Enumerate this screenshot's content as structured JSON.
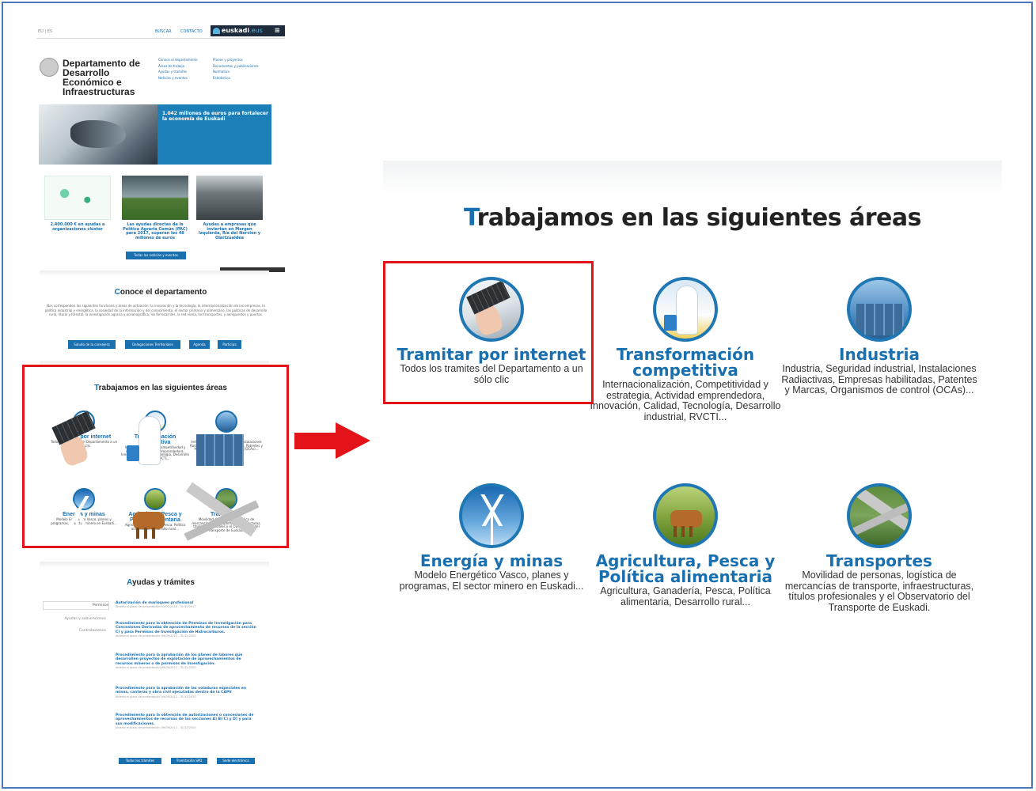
{
  "thumbnail": {
    "topbar": {
      "eu": "EU | ES",
      "buscar": "BUSCAR",
      "contacto": "CONTACTO",
      "brand": "euskadi",
      "brand_tld": ".eus",
      "menu_icon": "hamburger-icon"
    },
    "department": {
      "title": "Departamento de Desarrollo Económico e Infraestructuras",
      "links_col1": [
        "Conoce el departamento",
        "Áreas de trabajo",
        "Ayudas y trámites",
        "Noticias y eventos"
      ],
      "links_col2": [
        "Planes y proyectos",
        "Documentos y publicaciones",
        "Normativa",
        "Estadística"
      ]
    },
    "hero": {
      "text": "1.042 millones de euros para fortalecer la economía de Euskadi"
    },
    "news": [
      {
        "caption": "2.400.000 € en ayudas a organizaciones clúster"
      },
      {
        "caption": "Las ayudas directas de la Política Agraria Común (PAC) para 2017, superan los 48 millones de euros"
      },
      {
        "caption": "Ayudas a empresas que inviertan en Margen Izquierda, Ría del Nervión y Oiartzualdea"
      }
    ],
    "news_button": "Todas las noticias y eventos",
    "conoce": {
      "title_first": "C",
      "title_rest": "onoce el departamento",
      "text": "Nos corresponden las siguientes funciones y áreas de actuación: la innovación y la tecnología, la internacionalización de las empresas, la política industrial y energética, la sociedad de la información y del conocimiento, el sector primario y alimentario, las políticas de desarrollo rural, litoral y forestal, la investigación agraria y oceanográfica, los ferrocarriles, la red viaria, los transportes, y aeropuertos y puertos.",
      "buttons": [
        "Saludo de la consejera",
        "Delegaciones Territoriales",
        "Agenda",
        "Participa"
      ]
    },
    "areas": {
      "title_first": "T",
      "title_rest": "rabajamos en las siguientes áreas",
      "items": [
        {
          "title": "Tramitar por internet",
          "desc": "Todos los trámites del Departamento a un sólo clic"
        },
        {
          "title": "Transformación competitiva",
          "desc": "Internacionalización, Competitividad y estrategia, Actividad emprendedora, Innovación, Calidad, Tecnología, Desarrollo industrial, RVCTI..."
        },
        {
          "title": "Industria",
          "desc": "Industria, Seguridad industrial, Instalaciones Radiactivas, Empresas habilitadas, Patentes y Marcas, Organismos de control (OCAs)..."
        },
        {
          "title": "Energía y minas",
          "desc": "Modelo Energético Vasco, planes y programas, El sector minero en Euskadi..."
        },
        {
          "title": "Agricultura, Pesca y Política alimentaria",
          "desc": "Agricultura, Ganadería, Pesca, Política alimentaria, Desarrollo rural..."
        },
        {
          "title": "Transportes",
          "desc": "Movilidad de personas, logística de mercancías de transporte, infraestructuras, títulos profesionales y el Observatorio del Transporte de Euskadi."
        }
      ]
    },
    "ayudas": {
      "title_first": "A",
      "title_rest": "yudas y trámites",
      "tabs": [
        "Permisos",
        "Ayudas y subvenciones",
        "Contrataciones"
      ],
      "items": [
        {
          "title": "Autorización de marisqueo profesional",
          "meta": "Abierto el plazo de presentación 01/01/2016 - 31/12/2017"
        },
        {
          "title": "Procedimiento para la obtención de Permisos de Investigación para Concesiones Derivadas de aprovechamiento de recursos de la sección C) y para Permisos de Investigación de Hidrocarburos.",
          "meta": "Abierto el plazo de presentación 09/09/2012 - 31/12/2020"
        },
        {
          "title": "Procedimiento para la aprobación de los planes de labores que desarrollen proyectos de explotación de aprovechamientos de recursos mineros o de permisos de investigación.",
          "meta": "Abierto el plazo de presentación 09/09/2012 - 31/12/2020"
        },
        {
          "title": "Procedimiento para la aprobación de las voladuras especiales en minas, canteras y obra civil ejecutadas dentro de la CAPV",
          "meta": "Abierto el plazo de presentación 09/09/2012 - 31/12/2020"
        },
        {
          "title": "Procedimiento para la obtención de autorizaciones o concesiones de aprovechamientos de recursos de las secciones A) B) C) y D) y para sus modificaciones.",
          "meta": "Abierto el plazo de presentación 09/09/2012 - 31/12/2020"
        }
      ],
      "buttons": [
        "Todos los trámites",
        "Tramitación SPD",
        "Sede electrónica"
      ]
    }
  },
  "main": {
    "title_first": "T",
    "title_rest": "rabajamos en las siguientes áreas",
    "areas": [
      {
        "title": "Tramitar por internet",
        "desc": "Todos los tramites del Departamento a un sólo clic",
        "icon": "laptop-hand-icon"
      },
      {
        "title": "Transformación competitiva",
        "desc": "Internacionalización, Competitividad y estrategia, Actividad emprendedora, Innovación, Calidad, Tecnología, Desarrollo industrial, RVCTI...",
        "icon": "scientist-icon"
      },
      {
        "title": "Industria",
        "desc": "Industria, Seguridad industrial, Instalaciones Radiactivas, Empresas habilitadas, Patentes y Marcas, Organismos de control (OCAs)...",
        "icon": "industry-tanks-icon"
      },
      {
        "title": "Energía y minas",
        "desc": "Modelo Energético Vasco, planes y programas, El sector minero en Euskadi...",
        "icon": "wind-turbine-icon"
      },
      {
        "title": "Agricultura, Pesca y Política alimentaria",
        "desc": "Agricultura, Ganadería, Pesca, Política alimentaria, Desarrollo rural...",
        "icon": "cow-icon"
      },
      {
        "title": "Transportes",
        "desc": "Movilidad de personas, logística de mercancías de transporte, infraestructuras, títulos profesionales y el Observatorio del Transporte de Euskadi.",
        "icon": "highway-icon"
      }
    ]
  },
  "colors": {
    "accent": "#1a6fae",
    "highlight": "#e2141a",
    "frame": "#4a78b8"
  }
}
